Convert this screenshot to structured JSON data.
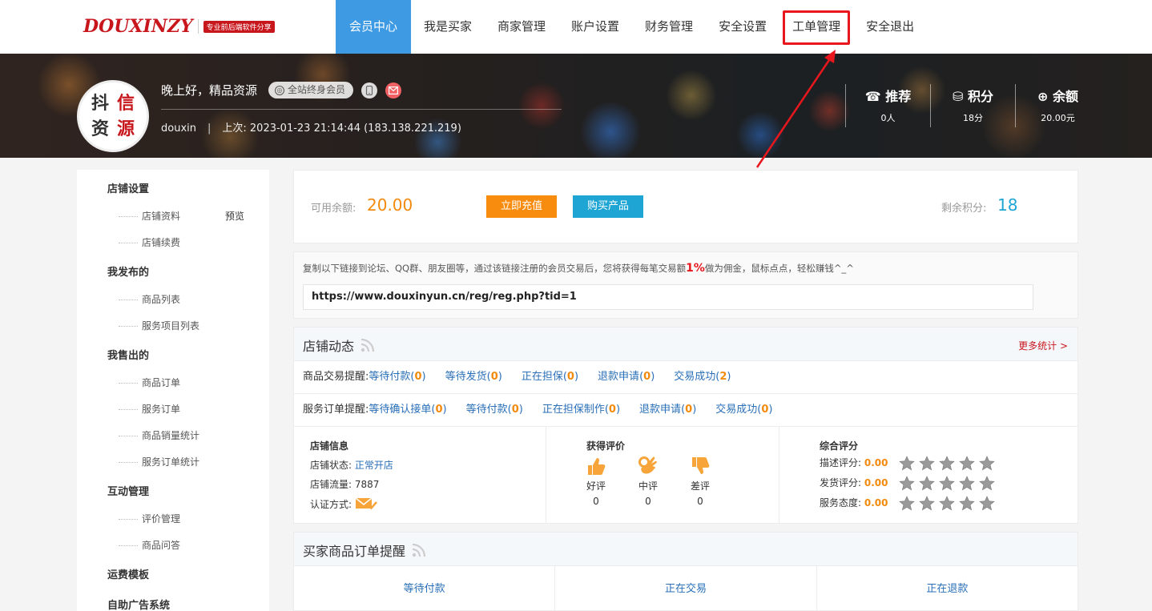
{
  "logo": {
    "text": "DOUXINZY",
    "tagline": "专业前后端软件分享"
  },
  "nav": [
    {
      "label": "会员中心",
      "active": true
    },
    {
      "label": "我是买家"
    },
    {
      "label": "商家管理"
    },
    {
      "label": "账户设置"
    },
    {
      "label": "财务管理"
    },
    {
      "label": "安全设置"
    },
    {
      "label": "工单管理",
      "highlighted": true
    },
    {
      "label": "安全退出"
    }
  ],
  "user": {
    "avatar_chars": [
      "抖",
      "信",
      "资",
      "源"
    ],
    "greeting": "晚上好，精品资源",
    "vip_badge": "全站终身会员",
    "username": "douxin",
    "last_login": "上次: 2023-01-23 21:14:44 (183.138.221.219)"
  },
  "stats": [
    {
      "icon": "phone-icon",
      "glyph": "☎",
      "label": "推荐",
      "value": "0人"
    },
    {
      "icon": "database-icon",
      "glyph": "⛁",
      "label": "积分",
      "value": "18分"
    },
    {
      "icon": "wallet-icon",
      "glyph": "⊕",
      "label": "余额",
      "value": "20.00元"
    }
  ],
  "sidebar": [
    {
      "title": "店铺设置",
      "items": [
        {
          "label": "店铺资料",
          "extra": "预览"
        },
        {
          "label": "店铺续费"
        }
      ]
    },
    {
      "title": "我发布的",
      "items": [
        {
          "label": "商品列表"
        },
        {
          "label": "服务项目列表"
        }
      ]
    },
    {
      "title": "我售出的",
      "items": [
        {
          "label": "商品订单"
        },
        {
          "label": "服务订单"
        },
        {
          "label": "商品销量统计"
        },
        {
          "label": "服务订单统计"
        }
      ]
    },
    {
      "title": "互动管理",
      "items": [
        {
          "label": "评价管理"
        },
        {
          "label": "商品问答"
        }
      ]
    },
    {
      "title": "运费模板",
      "items": []
    },
    {
      "title": "自助广告系统",
      "items": []
    }
  ],
  "balance": {
    "label": "可用余额:",
    "value": "20.00",
    "recharge_label": "立即充值",
    "buy_label": "购买产品",
    "points_label": "剩余积分:",
    "points_value": "18"
  },
  "referral": {
    "desc_pre": "复制以下链接到论坛、QQ群、朋友圈等，通过该链接注册的会员交易后，您将获得每笔交易额",
    "desc_pct": "1%",
    "desc_post": "做为佣金，鼠标点点，轻松赚钱^_^",
    "url": "https://www.douxinyun.cn/reg/reg.php?tid=1"
  },
  "shop_dynamics": {
    "title": "店铺动态",
    "more": "更多统计 >",
    "rows": [
      {
        "label": "商品交易提醒:",
        "links": [
          {
            "text": "等待付款",
            "count": "0"
          },
          {
            "text": "等待发货",
            "count": "0"
          },
          {
            "text": "正在担保",
            "count": "0"
          },
          {
            "text": "退款申请",
            "count": "0"
          },
          {
            "text": "交易成功",
            "count": "2"
          }
        ]
      },
      {
        "label": "服务订单提醒:",
        "links": [
          {
            "text": "等待确认接单",
            "count": "0"
          },
          {
            "text": "等待付款",
            "count": "0"
          },
          {
            "text": "正在担保制作",
            "count": "0"
          },
          {
            "text": "退款申请",
            "count": "0"
          },
          {
            "text": "交易成功",
            "count": "0"
          }
        ]
      }
    ],
    "shop_info": {
      "title": "店铺信息",
      "status_label": "店铺状态:",
      "status_value": "正常开店",
      "traffic_label": "店铺流量:",
      "traffic_value": "7887",
      "cert_label": "认证方式:"
    },
    "reviews": {
      "title": "获得评价",
      "items": [
        {
          "label": "好评",
          "count": "0",
          "icon": "thumbs-up-icon"
        },
        {
          "label": "中评",
          "count": "0",
          "icon": "ok-hand-icon"
        },
        {
          "label": "差评",
          "count": "0",
          "icon": "thumbs-down-icon"
        }
      ]
    },
    "ratings": {
      "title": "综合评分",
      "items": [
        {
          "label": "描述评分:",
          "value": "0.00",
          "stars": 0
        },
        {
          "label": "发货评分:",
          "value": "0.00",
          "stars": 0
        },
        {
          "label": "服务态度:",
          "value": "0.00",
          "stars": 0
        }
      ]
    }
  },
  "buyer_orders": {
    "title": "买家商品订单提醒",
    "cells": [
      "等待付款",
      "正在交易",
      "正在退款"
    ]
  },
  "colors": {
    "accent": "#3d9ae3",
    "orange": "#f78c0f",
    "blue": "#1ea5d4",
    "highlight": "#e8171d"
  }
}
